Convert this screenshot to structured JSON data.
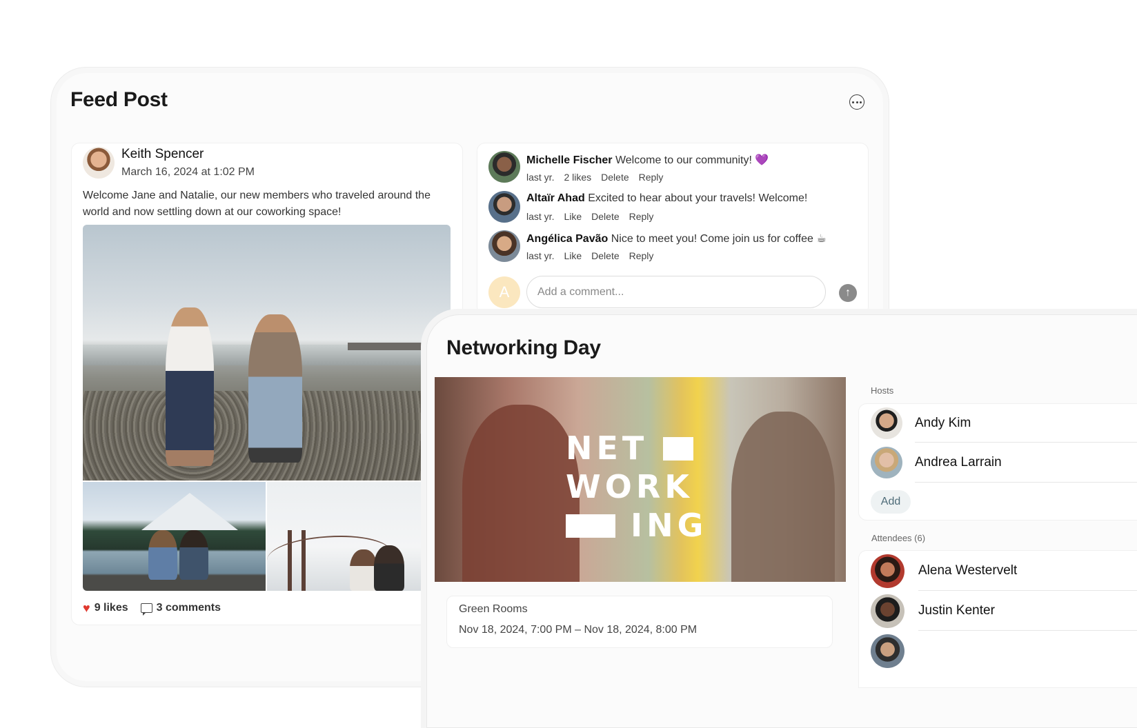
{
  "feed": {
    "title": "Feed Post",
    "more_icon": "more-horizontal-icon",
    "post": {
      "author": "Keith Spencer",
      "date": "March 16, 2024 at 1:02 PM",
      "body": "Welcome Jane and Natalie, our new members who traveled around the world and now settling down at our coworking space!",
      "likes_label": "9 likes",
      "comments_label": "3 comments"
    },
    "comments": [
      {
        "author": "Michelle Fischer",
        "text": "Welcome to our community! 💜",
        "time": "last yr.",
        "a1": "2 likes",
        "a2": "Delete",
        "a3": "Reply"
      },
      {
        "author": "Altaïr Ahad",
        "text": "Excited to hear about your travels! Welcome!",
        "time": "last yr.",
        "a1": "Like",
        "a2": "Delete",
        "a3": "Reply"
      },
      {
        "author": "Angélica Pavão",
        "text": "Nice to meet you! Come join us for coffee ☕",
        "time": "last yr.",
        "a1": "Like",
        "a2": "Delete",
        "a3": "Reply"
      }
    ],
    "comment_input": {
      "avatar_letter": "A",
      "placeholder": "Add a comment...",
      "send_icon": "arrow-up-icon"
    }
  },
  "event": {
    "title": "Networking Day",
    "hero_logo": {
      "line1": "NET",
      "line2": "WORK",
      "line3": "ING"
    },
    "location": "Green Rooms",
    "datetime": "Nov 18, 2024, 7:00 PM – Nov 18, 2024, 8:00 PM",
    "hosts_label": "Hosts",
    "hosts": [
      "Andy Kim",
      "Andrea Larrain"
    ],
    "add_label": "Add",
    "attendees_label": "Attendees (6)",
    "attendees": [
      "Alena Westervelt",
      "Justin Kenter"
    ]
  },
  "colors": {
    "like_heart": "#e0392f",
    "accent_add": "#4e6b78",
    "input_avatar": "#fbe7bf"
  }
}
